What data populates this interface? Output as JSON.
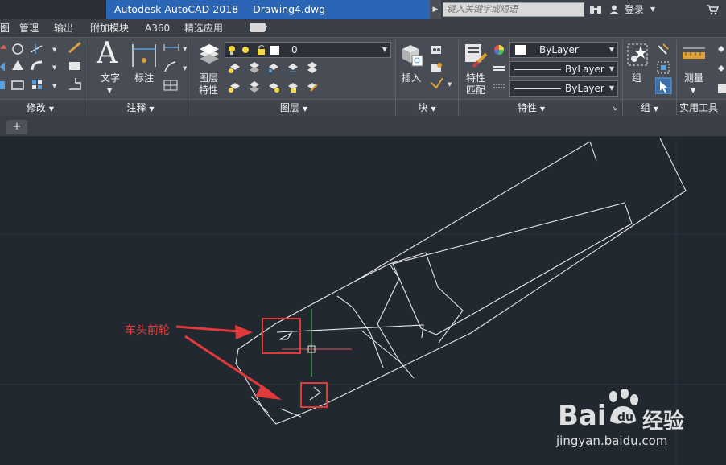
{
  "titlebar": {
    "app_title": "Autodesk AutoCAD 2018",
    "doc_title": "Drawing4.dwg",
    "search_placeholder": "键入关键字或短语",
    "login_label": "登录"
  },
  "menu": {
    "partial_first": "图",
    "items": [
      "管理",
      "输出",
      "附加模块",
      "A360",
      "精选应用"
    ]
  },
  "ribbon": {
    "panels": {
      "modify": "修改",
      "annotation": "注释",
      "layers": "图层",
      "block": "块",
      "properties": "特性",
      "groups": "组",
      "utilities": "实用工具"
    },
    "text_label": "文字",
    "dimension_label": "标注",
    "layer_props_line1": "图层",
    "layer_props_line2": "特性",
    "layer_dropdown_value": "0",
    "insert_label": "插入",
    "match_line1": "特性",
    "match_line2": "匹配",
    "color_value": "ByLayer",
    "linetype_value": "ByLayer",
    "lineweight_value": "ByLayer",
    "group_label": "组",
    "measure_label": "测量"
  },
  "tabs": {
    "new_tab": "+"
  },
  "canvas": {
    "annotation_label": "车头前轮",
    "annotation_color": "#e03a3a",
    "crosshair_vertical_color": "#5fd35f",
    "crosshair_horizontal_color": "#e05050"
  },
  "watermark": {
    "brand_left": "Bai",
    "brand_right": "经验",
    "url": "jingyan.baidu.com"
  }
}
